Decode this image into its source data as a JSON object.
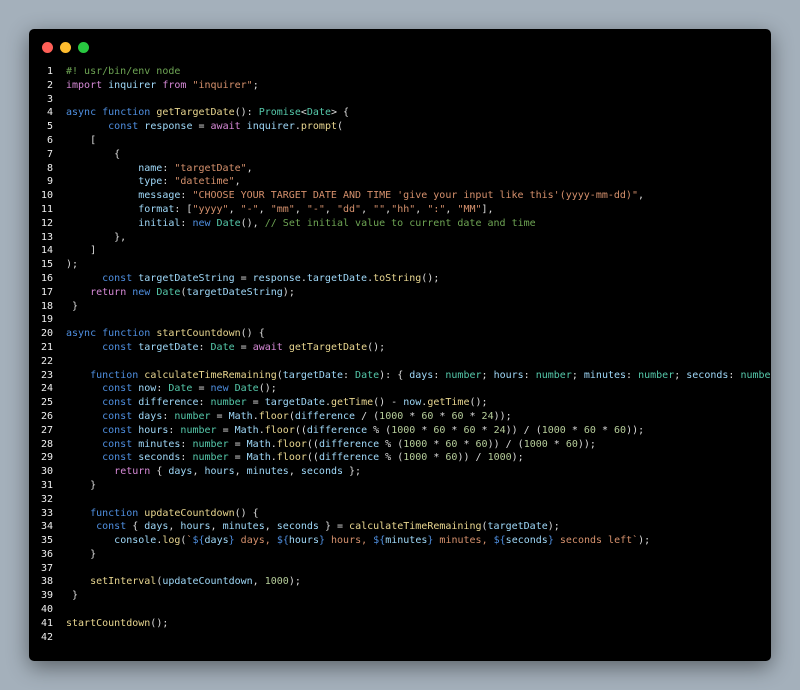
{
  "window": {
    "controls": [
      {
        "name": "close",
        "color": "#ff5f57"
      },
      {
        "name": "minimize",
        "color": "#febc2e"
      },
      {
        "name": "maximize",
        "color": "#28c840"
      }
    ]
  },
  "code_lines": [
    [
      [
        "#! usr/bin/env node",
        "c"
      ]
    ],
    [
      [
        "import",
        "m"
      ],
      [
        " inquirer ",
        "v"
      ],
      [
        "from",
        "m"
      ],
      [
        " ",
        "p"
      ],
      [
        "\"inquirer\"",
        "s"
      ],
      [
        ";",
        "p"
      ]
    ],
    [],
    [
      [
        "async",
        "k"
      ],
      [
        " ",
        "p"
      ],
      [
        "function",
        "k"
      ],
      [
        " ",
        "p"
      ],
      [
        "getTargetDate",
        "f"
      ],
      [
        "(): ",
        "p"
      ],
      [
        "Promise",
        "t"
      ],
      [
        "<",
        "p"
      ],
      [
        "Date",
        "t"
      ],
      [
        "> {",
        "p"
      ]
    ],
    [
      [
        "       ",
        "p"
      ],
      [
        "const",
        "k"
      ],
      [
        " ",
        "p"
      ],
      [
        "response",
        "v"
      ],
      [
        " = ",
        "p"
      ],
      [
        "await",
        "m"
      ],
      [
        " ",
        "p"
      ],
      [
        "inquirer",
        "v"
      ],
      [
        ".",
        "p"
      ],
      [
        "prompt",
        "f"
      ],
      [
        "(",
        "p"
      ]
    ],
    [
      [
        "    [",
        "p"
      ]
    ],
    [
      [
        "        {",
        "p"
      ]
    ],
    [
      [
        "            ",
        "p"
      ],
      [
        "name",
        "v"
      ],
      [
        ": ",
        "p"
      ],
      [
        "\"targetDate\"",
        "s"
      ],
      [
        ",",
        "p"
      ]
    ],
    [
      [
        "            ",
        "p"
      ],
      [
        "type",
        "v"
      ],
      [
        ": ",
        "p"
      ],
      [
        "\"datetime\"",
        "s"
      ],
      [
        ",",
        "p"
      ]
    ],
    [
      [
        "            ",
        "p"
      ],
      [
        "message",
        "v"
      ],
      [
        ": ",
        "p"
      ],
      [
        "\"CHOOSE YOUR TARGET DATE AND TIME 'give your input like this'(yyyy-mm-dd)\"",
        "s"
      ],
      [
        ",",
        "p"
      ]
    ],
    [
      [
        "            ",
        "p"
      ],
      [
        "format",
        "v"
      ],
      [
        ": [",
        "p"
      ],
      [
        "\"yyyy\"",
        "s"
      ],
      [
        ", ",
        "p"
      ],
      [
        "\"-\"",
        "s"
      ],
      [
        ", ",
        "p"
      ],
      [
        "\"mm\"",
        "s"
      ],
      [
        ", ",
        "p"
      ],
      [
        "\"-\"",
        "s"
      ],
      [
        ", ",
        "p"
      ],
      [
        "\"dd\"",
        "s"
      ],
      [
        ", ",
        "p"
      ],
      [
        "\"\"",
        "s"
      ],
      [
        ",",
        "p"
      ],
      [
        "\"hh\"",
        "s"
      ],
      [
        ", ",
        "p"
      ],
      [
        "\":\"",
        "s"
      ],
      [
        ", ",
        "p"
      ],
      [
        "\"MM\"",
        "s"
      ],
      [
        "],",
        "p"
      ]
    ],
    [
      [
        "            ",
        "p"
      ],
      [
        "initial",
        "v"
      ],
      [
        ": ",
        "p"
      ],
      [
        "new",
        "k"
      ],
      [
        " ",
        "p"
      ],
      [
        "Date",
        "t"
      ],
      [
        "(), ",
        "p"
      ],
      [
        "// Set initial value to current date and time",
        "c"
      ]
    ],
    [
      [
        "        },",
        "p"
      ]
    ],
    [
      [
        "    ]",
        "p"
      ]
    ],
    [
      [
        ");",
        "p"
      ]
    ],
    [
      [
        "      ",
        "p"
      ],
      [
        "const",
        "k"
      ],
      [
        " ",
        "p"
      ],
      [
        "targetDateString",
        "v"
      ],
      [
        " = ",
        "p"
      ],
      [
        "response",
        "v"
      ],
      [
        ".",
        "p"
      ],
      [
        "targetDate",
        "v"
      ],
      [
        ".",
        "p"
      ],
      [
        "toString",
        "f"
      ],
      [
        "();",
        "p"
      ]
    ],
    [
      [
        "    ",
        "p"
      ],
      [
        "return",
        "m"
      ],
      [
        " ",
        "p"
      ],
      [
        "new",
        "k"
      ],
      [
        " ",
        "p"
      ],
      [
        "Date",
        "t"
      ],
      [
        "(",
        "p"
      ],
      [
        "targetDateString",
        "v"
      ],
      [
        ");",
        "p"
      ]
    ],
    [
      [
        " }",
        "p"
      ]
    ],
    [],
    [
      [
        "async",
        "k"
      ],
      [
        " ",
        "p"
      ],
      [
        "function",
        "k"
      ],
      [
        " ",
        "p"
      ],
      [
        "startCountdown",
        "f"
      ],
      [
        "() {",
        "p"
      ]
    ],
    [
      [
        "      ",
        "p"
      ],
      [
        "const",
        "k"
      ],
      [
        " ",
        "p"
      ],
      [
        "targetDate",
        "v"
      ],
      [
        ": ",
        "p"
      ],
      [
        "Date",
        "t"
      ],
      [
        " = ",
        "p"
      ],
      [
        "await",
        "m"
      ],
      [
        " ",
        "p"
      ],
      [
        "getTargetDate",
        "f"
      ],
      [
        "();",
        "p"
      ]
    ],
    [],
    [
      [
        "    ",
        "p"
      ],
      [
        "function",
        "k"
      ],
      [
        " ",
        "p"
      ],
      [
        "calculateTimeRemaining",
        "f"
      ],
      [
        "(",
        "p"
      ],
      [
        "targetDate",
        "v"
      ],
      [
        ": ",
        "p"
      ],
      [
        "Date",
        "t"
      ],
      [
        "): { ",
        "p"
      ],
      [
        "days",
        "v"
      ],
      [
        ": ",
        "p"
      ],
      [
        "number",
        "t"
      ],
      [
        "; ",
        "p"
      ],
      [
        "hours",
        "v"
      ],
      [
        ": ",
        "p"
      ],
      [
        "number",
        "t"
      ],
      [
        "; ",
        "p"
      ],
      [
        "minutes",
        "v"
      ],
      [
        ": ",
        "p"
      ],
      [
        "number",
        "t"
      ],
      [
        "; ",
        "p"
      ],
      [
        "seconds",
        "v"
      ],
      [
        ": ",
        "p"
      ],
      [
        "number",
        "t"
      ],
      [
        " } {",
        "p"
      ]
    ],
    [
      [
        "      ",
        "p"
      ],
      [
        "const",
        "k"
      ],
      [
        " ",
        "p"
      ],
      [
        "now",
        "v"
      ],
      [
        ": ",
        "p"
      ],
      [
        "Date",
        "t"
      ],
      [
        " = ",
        "p"
      ],
      [
        "new",
        "k"
      ],
      [
        " ",
        "p"
      ],
      [
        "Date",
        "t"
      ],
      [
        "();",
        "p"
      ]
    ],
    [
      [
        "      ",
        "p"
      ],
      [
        "const",
        "k"
      ],
      [
        " ",
        "p"
      ],
      [
        "difference",
        "v"
      ],
      [
        ": ",
        "p"
      ],
      [
        "number",
        "t"
      ],
      [
        " = ",
        "p"
      ],
      [
        "targetDate",
        "v"
      ],
      [
        ".",
        "p"
      ],
      [
        "getTime",
        "f"
      ],
      [
        "() - ",
        "p"
      ],
      [
        "now",
        "v"
      ],
      [
        ".",
        "p"
      ],
      [
        "getTime",
        "f"
      ],
      [
        "();",
        "p"
      ]
    ],
    [
      [
        "      ",
        "p"
      ],
      [
        "const",
        "k"
      ],
      [
        " ",
        "p"
      ],
      [
        "days",
        "v"
      ],
      [
        ": ",
        "p"
      ],
      [
        "number",
        "t"
      ],
      [
        " = ",
        "p"
      ],
      [
        "Math",
        "v"
      ],
      [
        ".",
        "p"
      ],
      [
        "floor",
        "f"
      ],
      [
        "(",
        "p"
      ],
      [
        "difference",
        "v"
      ],
      [
        " / (",
        "p"
      ],
      [
        "1000",
        "n"
      ],
      [
        " * ",
        "p"
      ],
      [
        "60",
        "n"
      ],
      [
        " * ",
        "p"
      ],
      [
        "60",
        "n"
      ],
      [
        " * ",
        "p"
      ],
      [
        "24",
        "n"
      ],
      [
        "));",
        "p"
      ]
    ],
    [
      [
        "      ",
        "p"
      ],
      [
        "const",
        "k"
      ],
      [
        " ",
        "p"
      ],
      [
        "hours",
        "v"
      ],
      [
        ": ",
        "p"
      ],
      [
        "number",
        "t"
      ],
      [
        " = ",
        "p"
      ],
      [
        "Math",
        "v"
      ],
      [
        ".",
        "p"
      ],
      [
        "floor",
        "f"
      ],
      [
        "((",
        "p"
      ],
      [
        "difference",
        "v"
      ],
      [
        " % (",
        "p"
      ],
      [
        "1000",
        "n"
      ],
      [
        " * ",
        "p"
      ],
      [
        "60",
        "n"
      ],
      [
        " * ",
        "p"
      ],
      [
        "60",
        "n"
      ],
      [
        " * ",
        "p"
      ],
      [
        "24",
        "n"
      ],
      [
        ")) / (",
        "p"
      ],
      [
        "1000",
        "n"
      ],
      [
        " * ",
        "p"
      ],
      [
        "60",
        "n"
      ],
      [
        " * ",
        "p"
      ],
      [
        "60",
        "n"
      ],
      [
        "));",
        "p"
      ]
    ],
    [
      [
        "      ",
        "p"
      ],
      [
        "const",
        "k"
      ],
      [
        " ",
        "p"
      ],
      [
        "minutes",
        "v"
      ],
      [
        ": ",
        "p"
      ],
      [
        "number",
        "t"
      ],
      [
        " = ",
        "p"
      ],
      [
        "Math",
        "v"
      ],
      [
        ".",
        "p"
      ],
      [
        "floor",
        "f"
      ],
      [
        "((",
        "p"
      ],
      [
        "difference",
        "v"
      ],
      [
        " % (",
        "p"
      ],
      [
        "1000",
        "n"
      ],
      [
        " * ",
        "p"
      ],
      [
        "60",
        "n"
      ],
      [
        " * ",
        "p"
      ],
      [
        "60",
        "n"
      ],
      [
        ")) / (",
        "p"
      ],
      [
        "1000",
        "n"
      ],
      [
        " * ",
        "p"
      ],
      [
        "60",
        "n"
      ],
      [
        "));",
        "p"
      ]
    ],
    [
      [
        "      ",
        "p"
      ],
      [
        "const",
        "k"
      ],
      [
        " ",
        "p"
      ],
      [
        "seconds",
        "v"
      ],
      [
        ": ",
        "p"
      ],
      [
        "number",
        "t"
      ],
      [
        " = ",
        "p"
      ],
      [
        "Math",
        "v"
      ],
      [
        ".",
        "p"
      ],
      [
        "floor",
        "f"
      ],
      [
        "((",
        "p"
      ],
      [
        "difference",
        "v"
      ],
      [
        " % (",
        "p"
      ],
      [
        "1000",
        "n"
      ],
      [
        " * ",
        "p"
      ],
      [
        "60",
        "n"
      ],
      [
        ")) / ",
        "p"
      ],
      [
        "1000",
        "n"
      ],
      [
        ");",
        "p"
      ]
    ],
    [
      [
        "        ",
        "p"
      ],
      [
        "return",
        "m"
      ],
      [
        " { ",
        "p"
      ],
      [
        "days",
        "v"
      ],
      [
        ", ",
        "p"
      ],
      [
        "hours",
        "v"
      ],
      [
        ", ",
        "p"
      ],
      [
        "minutes",
        "v"
      ],
      [
        ", ",
        "p"
      ],
      [
        "seconds",
        "v"
      ],
      [
        " };",
        "p"
      ]
    ],
    [
      [
        "    }",
        "p"
      ]
    ],
    [],
    [
      [
        "    ",
        "p"
      ],
      [
        "function",
        "k"
      ],
      [
        " ",
        "p"
      ],
      [
        "updateCountdown",
        "f"
      ],
      [
        "() {",
        "p"
      ]
    ],
    [
      [
        "     ",
        "p"
      ],
      [
        "const",
        "k"
      ],
      [
        " { ",
        "p"
      ],
      [
        "days",
        "v"
      ],
      [
        ", ",
        "p"
      ],
      [
        "hours",
        "v"
      ],
      [
        ", ",
        "p"
      ],
      [
        "minutes",
        "v"
      ],
      [
        ", ",
        "p"
      ],
      [
        "seconds",
        "v"
      ],
      [
        " } = ",
        "p"
      ],
      [
        "calculateTimeRemaining",
        "f"
      ],
      [
        "(",
        "p"
      ],
      [
        "targetDate",
        "v"
      ],
      [
        ");",
        "p"
      ]
    ],
    [
      [
        "        ",
        "p"
      ],
      [
        "console",
        "v"
      ],
      [
        ".",
        "p"
      ],
      [
        "log",
        "f"
      ],
      [
        "(",
        "p"
      ],
      [
        "`",
        "s"
      ],
      [
        "${",
        "k"
      ],
      [
        "days",
        "v"
      ],
      [
        "}",
        "k"
      ],
      [
        " days, ",
        "s"
      ],
      [
        "${",
        "k"
      ],
      [
        "hours",
        "v"
      ],
      [
        "}",
        "k"
      ],
      [
        " hours, ",
        "s"
      ],
      [
        "${",
        "k"
      ],
      [
        "minutes",
        "v"
      ],
      [
        "}",
        "k"
      ],
      [
        " minutes, ",
        "s"
      ],
      [
        "${",
        "k"
      ],
      [
        "seconds",
        "v"
      ],
      [
        "}",
        "k"
      ],
      [
        " seconds left`",
        "s"
      ],
      [
        ");",
        "p"
      ]
    ],
    [
      [
        "    }",
        "p"
      ]
    ],
    [],
    [
      [
        "    ",
        "p"
      ],
      [
        "setInterval",
        "f"
      ],
      [
        "(",
        "p"
      ],
      [
        "updateCountdown",
        "v"
      ],
      [
        ", ",
        "p"
      ],
      [
        "1000",
        "n"
      ],
      [
        ");",
        "p"
      ]
    ],
    [
      [
        " }",
        "p"
      ]
    ],
    [],
    [
      [
        "startCountdown",
        "f"
      ],
      [
        "();",
        "p"
      ]
    ],
    []
  ]
}
